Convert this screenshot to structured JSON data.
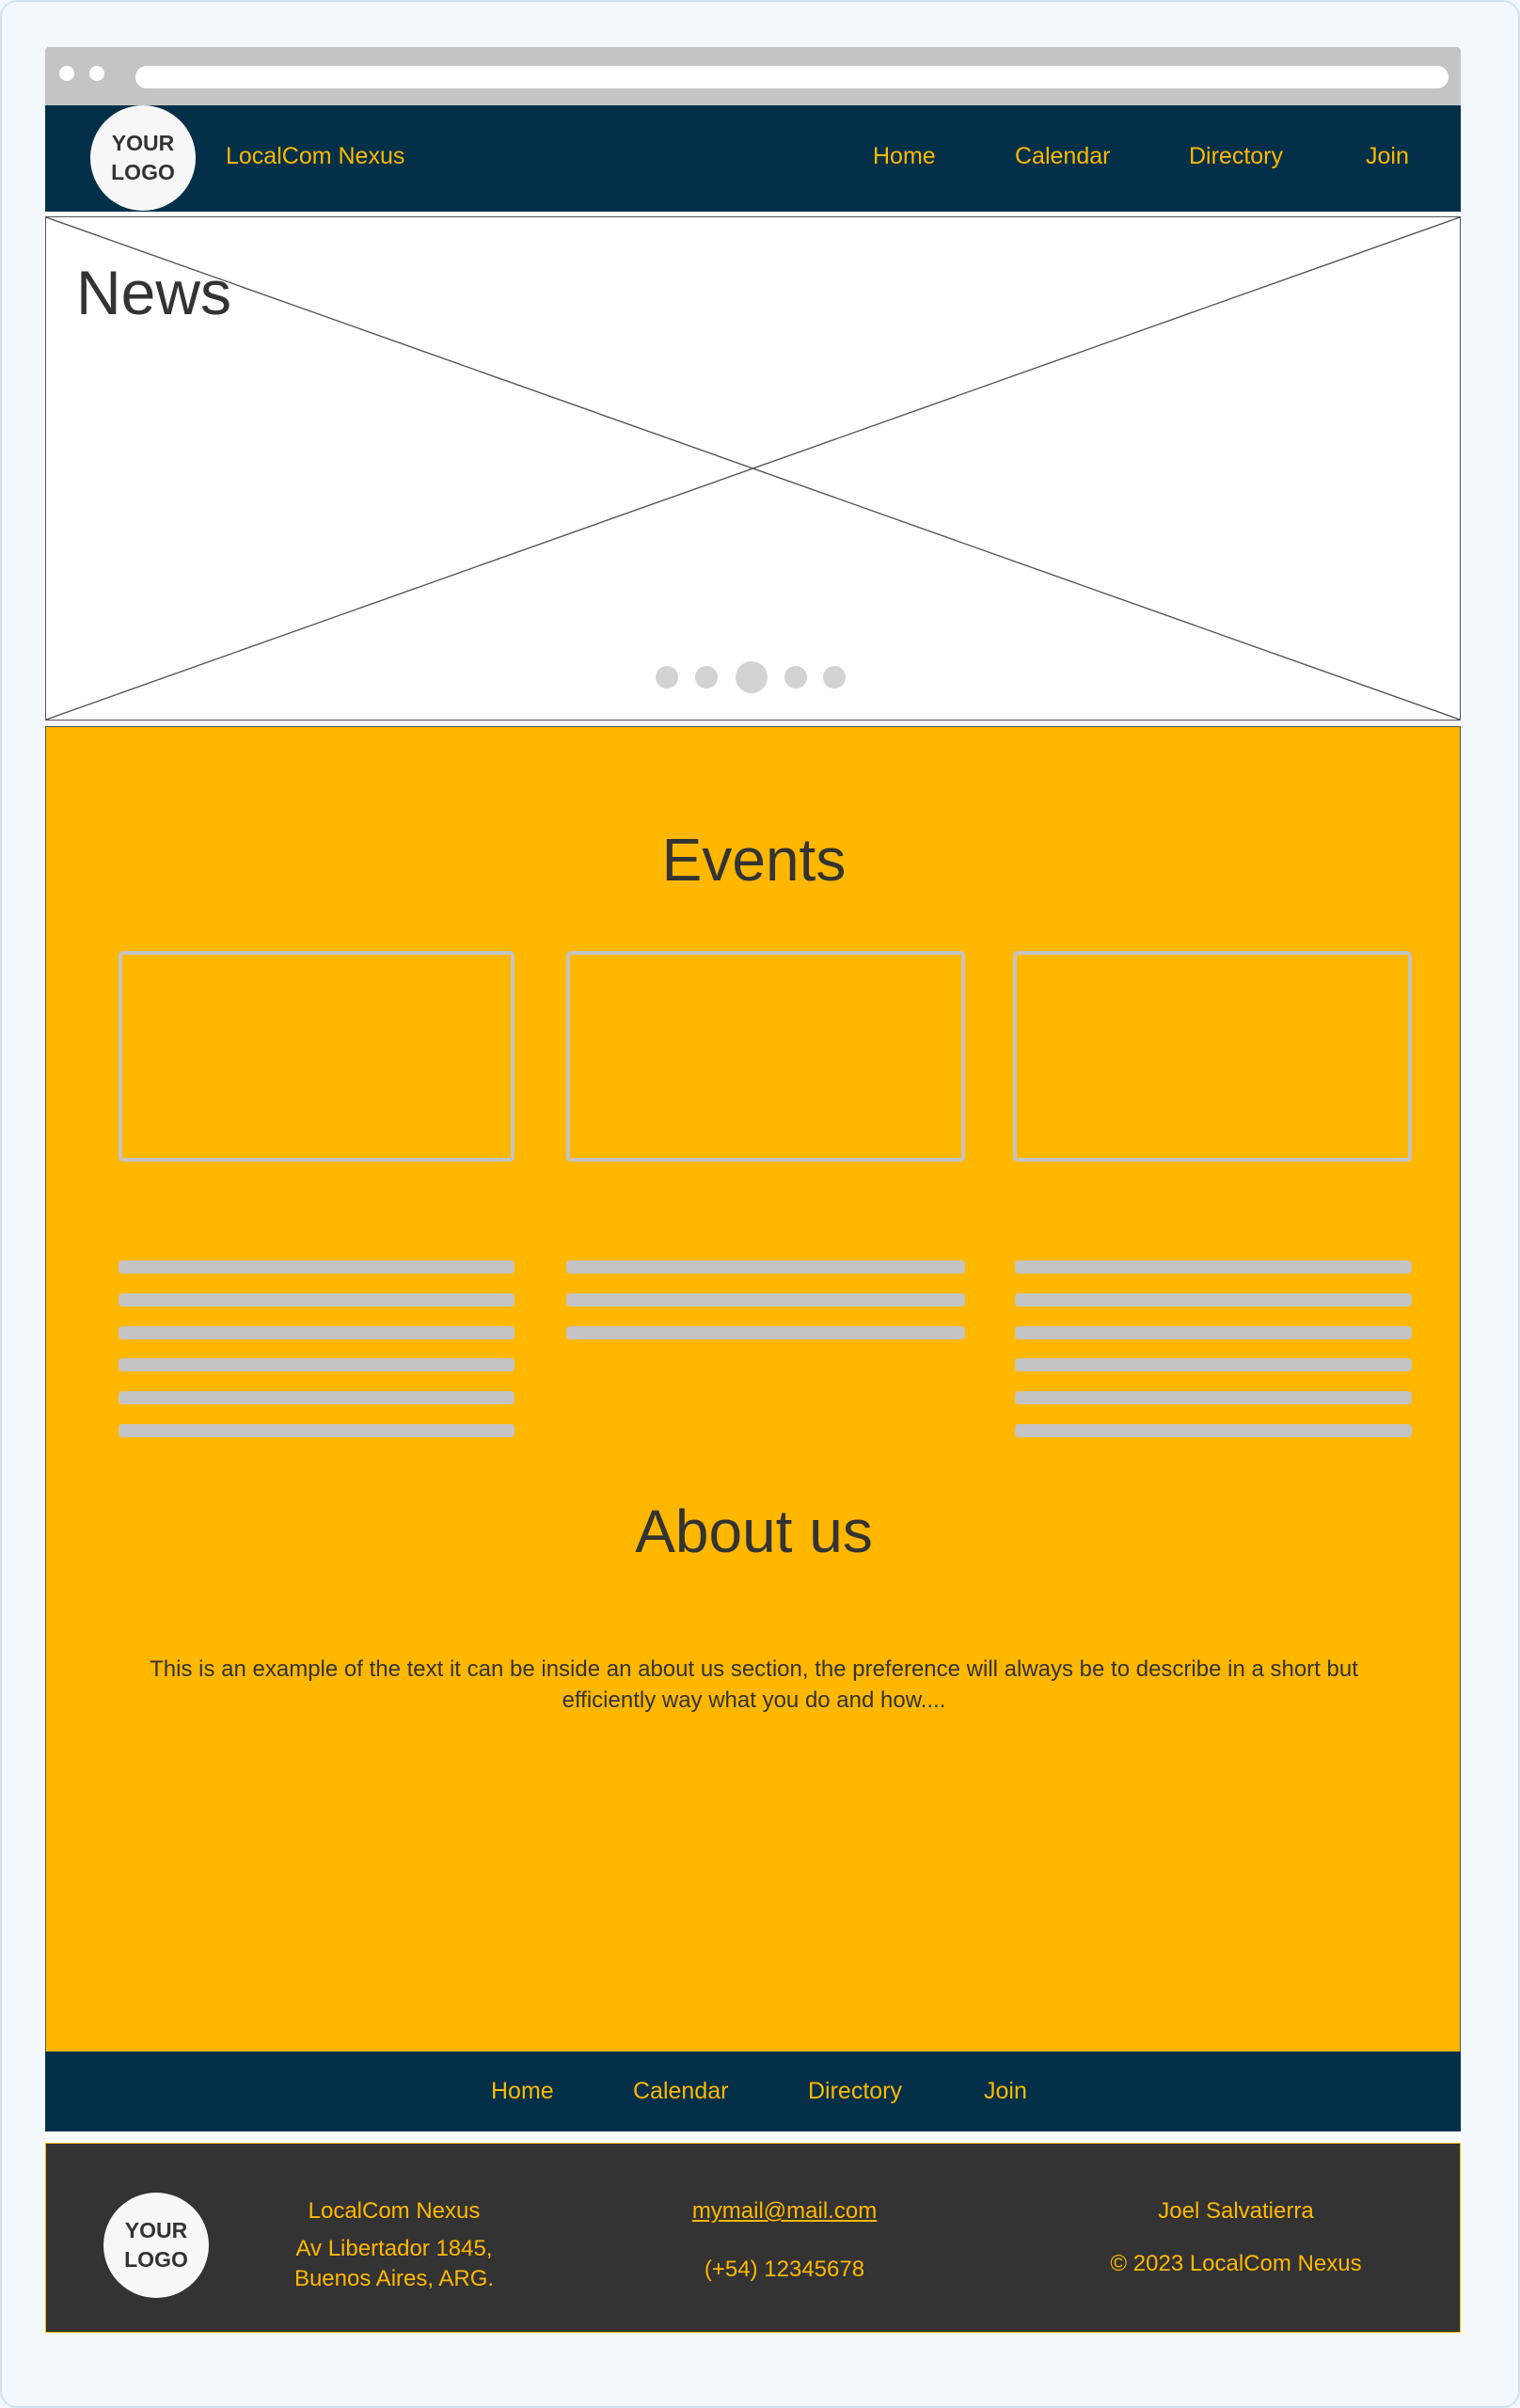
{
  "header": {
    "logo_text": "YOUR LOGO",
    "brand": "LocalCom Nexus",
    "nav": [
      "Home",
      "Calendar",
      "Directory",
      "Join"
    ]
  },
  "hero": {
    "title": "News",
    "carousel_dots": 5,
    "active_dot": 2
  },
  "events": {
    "title": "Events",
    "cards": 3
  },
  "about": {
    "title": "About us",
    "text": "This is an example of the text it can be inside an about us section, the preference will always be to describe in a short but efficiently way what you do and how...."
  },
  "footer_nav": [
    "Home",
    "Calendar",
    "Directory",
    "Join"
  ],
  "footer": {
    "logo_text": "YOUR LOGO",
    "company": "LocalCom Nexus",
    "address_line1": "Av Libertador 1845,",
    "address_line2": "Buenos Aires, ARG.",
    "email": "mymail@mail.com",
    "phone": "(+54) 12345678",
    "author": "Joel Salvatierra",
    "copyright": "© 2023 LocalCom Nexus"
  },
  "colors": {
    "navy": "#033048",
    "accent": "#ffb800",
    "section_bg": "#ffb700",
    "footer_bg": "#333333",
    "placeholder": "#c4c4c4"
  }
}
